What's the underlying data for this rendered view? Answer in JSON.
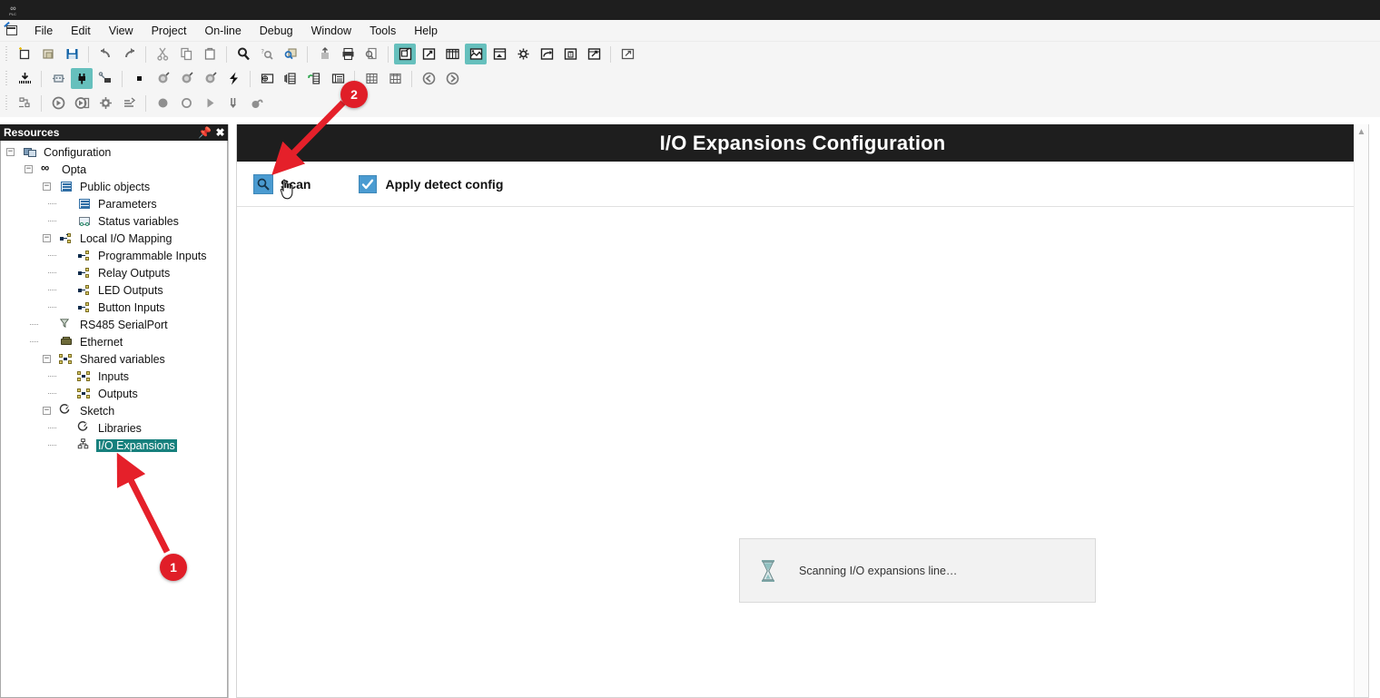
{
  "window": {
    "title": "",
    "app_logo": {
      "line1": "∞",
      "line2": "PLC"
    }
  },
  "menubar": {
    "app_icon": "project-icon",
    "items": [
      {
        "label": "File"
      },
      {
        "label": "Edit"
      },
      {
        "label": "View"
      },
      {
        "label": "Project"
      },
      {
        "label": "On-line"
      },
      {
        "label": "Debug"
      },
      {
        "label": "Window"
      },
      {
        "label": "Tools"
      },
      {
        "label": "Help"
      }
    ]
  },
  "toolbar": {
    "row1": [
      {
        "name": "new-project-icon",
        "selected": false
      },
      {
        "name": "open-project-icon",
        "selected": false
      },
      {
        "name": "save-icon",
        "selected": false
      },
      {
        "sep": true
      },
      {
        "name": "undo-icon",
        "selected": false
      },
      {
        "name": "redo-icon",
        "selected": false
      },
      {
        "sep": true
      },
      {
        "name": "cut-icon",
        "selected": false
      },
      {
        "name": "copy-icon",
        "selected": false
      },
      {
        "name": "paste-icon",
        "selected": false
      },
      {
        "sep": true
      },
      {
        "name": "find-icon",
        "selected": false
      },
      {
        "name": "find-next-icon",
        "selected": false
      },
      {
        "name": "find-in-project-icon",
        "selected": false
      },
      {
        "sep": true
      },
      {
        "name": "export-icon",
        "selected": false
      },
      {
        "name": "print-icon",
        "selected": false
      },
      {
        "name": "print-preview-icon",
        "selected": false
      },
      {
        "sep": true
      },
      {
        "name": "workspace-window-icon",
        "selected": true
      },
      {
        "name": "output-window-icon",
        "selected": false
      },
      {
        "name": "watch-window-icon",
        "selected": false
      },
      {
        "name": "resources-window-icon",
        "selected": true
      },
      {
        "name": "image-window-icon",
        "selected": false
      },
      {
        "name": "settings-window-icon",
        "selected": false
      },
      {
        "name": "restore-window-icon",
        "selected": false
      },
      {
        "name": "text-window-icon",
        "selected": false
      },
      {
        "name": "tools-window-icon",
        "selected": false
      },
      {
        "sep": true
      },
      {
        "name": "fullscreen-icon",
        "selected": false
      }
    ],
    "row2": [
      {
        "name": "download-code-icon",
        "selected": false
      },
      {
        "sep": true
      },
      {
        "name": "connect-device-icon",
        "selected": false
      },
      {
        "name": "plug-connect-icon",
        "selected": true
      },
      {
        "name": "disconnect-icon",
        "selected": false
      },
      {
        "sep": true
      },
      {
        "name": "stop-icon",
        "selected": false
      },
      {
        "name": "debug-mode-icon",
        "selected": false
      },
      {
        "name": "debug-mode2-icon",
        "selected": false
      },
      {
        "name": "debug-mode3-icon",
        "selected": false
      },
      {
        "name": "flash-icon",
        "selected": false
      },
      {
        "sep": true
      },
      {
        "name": "source-code-icon",
        "selected": false
      },
      {
        "name": "variables-icon",
        "selected": false
      },
      {
        "name": "refresh-variables-icon",
        "selected": false
      },
      {
        "name": "table-view-icon",
        "selected": false
      },
      {
        "sep": true
      },
      {
        "name": "grid-icon",
        "selected": false
      },
      {
        "name": "grid-alt-icon",
        "selected": false
      },
      {
        "sep": true
      },
      {
        "name": "back-icon",
        "selected": false
      },
      {
        "name": "forward-icon",
        "selected": false
      }
    ],
    "row3": [
      {
        "name": "network-config-icon",
        "selected": false
      },
      {
        "sep": true
      },
      {
        "name": "run-cycle-icon",
        "selected": false
      },
      {
        "name": "step-run-icon",
        "selected": false
      },
      {
        "name": "breakpoint-settings-icon",
        "selected": false
      },
      {
        "name": "trigger-icon",
        "selected": false
      },
      {
        "sep": true
      },
      {
        "name": "record-icon",
        "selected": false
      },
      {
        "name": "stop-record-icon",
        "selected": false
      },
      {
        "name": "play-icon",
        "selected": false
      },
      {
        "name": "step-into-icon",
        "selected": false
      },
      {
        "name": "watch-point-icon",
        "selected": false
      }
    ]
  },
  "resources_panel": {
    "title": "Resources",
    "pin_icon": "pin-icon",
    "close_icon": "close-icon",
    "tree": [
      {
        "label": "Configuration",
        "depth": 0,
        "icon": "configuration-icon",
        "expander": "-",
        "selected": false
      },
      {
        "label": "Opta",
        "depth": 1,
        "icon": "opta-icon",
        "expander": "-",
        "selected": false
      },
      {
        "label": "Public objects",
        "depth": 2,
        "icon": "public-objects-icon",
        "expander": "-",
        "selected": false
      },
      {
        "label": "Parameters",
        "depth": 3,
        "icon": "parameters-icon",
        "expander": "",
        "selected": false
      },
      {
        "label": "Status variables",
        "depth": 3,
        "icon": "status-variables-icon",
        "expander": "",
        "selected": false
      },
      {
        "label": "Local I/O Mapping",
        "depth": 2,
        "icon": "io-mapping-icon",
        "expander": "-",
        "selected": false
      },
      {
        "label": "Programmable Inputs",
        "depth": 3,
        "icon": "io-mapping-icon",
        "expander": "",
        "selected": false
      },
      {
        "label": "Relay Outputs",
        "depth": 3,
        "icon": "io-mapping-icon",
        "expander": "",
        "selected": false
      },
      {
        "label": "LED Outputs",
        "depth": 3,
        "icon": "io-mapping-icon",
        "expander": "",
        "selected": false
      },
      {
        "label": "Button Inputs",
        "depth": 3,
        "icon": "io-mapping-icon",
        "expander": "",
        "selected": false
      },
      {
        "label": "RS485 SerialPort",
        "depth": 2,
        "icon": "serial-port-icon",
        "expander": "",
        "selected": false
      },
      {
        "label": "Ethernet",
        "depth": 2,
        "icon": "ethernet-icon",
        "expander": "",
        "selected": false
      },
      {
        "label": "Shared variables",
        "depth": 2,
        "icon": "shared-variables-icon",
        "expander": "-",
        "selected": false
      },
      {
        "label": "Inputs",
        "depth": 3,
        "icon": "shared-variables-icon",
        "expander": "",
        "selected": false
      },
      {
        "label": "Outputs",
        "depth": 3,
        "icon": "shared-variables-icon",
        "expander": "",
        "selected": false
      },
      {
        "label": "Sketch",
        "depth": 2,
        "icon": "sketch-icon",
        "expander": "-",
        "selected": false
      },
      {
        "label": "Libraries",
        "depth": 3,
        "icon": "sketch-icon",
        "expander": "",
        "selected": false
      },
      {
        "label": "I/O Expansions",
        "depth": 3,
        "icon": "io-expansions-icon",
        "expander": "",
        "selected": true
      }
    ]
  },
  "main": {
    "page_title": "I/O Expansions Configuration",
    "scan_button": {
      "label": "Scan",
      "icon": "magnifier-icon"
    },
    "apply_checkbox": {
      "label": "Apply detect config",
      "checked": true,
      "icon": "checkmark-icon"
    },
    "status": {
      "text": "Scanning I/O expansions line…",
      "icon": "hourglass-icon"
    },
    "scrollbar": {
      "up_arrow_icon": "chevron-up-icon"
    }
  },
  "annotations": [
    {
      "number": "1",
      "target": "io-expansions-tree-node"
    },
    {
      "number": "2",
      "target": "scan-button"
    }
  ],
  "colors": {
    "accent_teal": "#17807d",
    "toolbar_selected": "#66c0bd",
    "title_bar": "#1e1e1e",
    "button_blue": "#4a9bd1",
    "annotation_red": "#e01e28"
  },
  "cursor": {
    "type": "pointing-hand"
  }
}
